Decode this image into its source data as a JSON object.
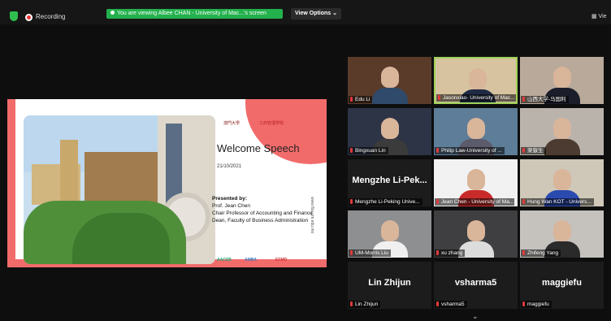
{
  "topbar": {
    "recording_label": "Recording",
    "viewing_banner": "You are viewing Albee CHAN - University of Mac...'s screen",
    "view_options_label": "View Options ⌄",
    "view_label": "▦ Vie"
  },
  "slide": {
    "title": "Welcome Speech",
    "date": "21/10/2021",
    "presented_by": "Presented by:",
    "presenter_name": "Prof. Jean Chen",
    "presenter_role1": "Chair Professor of Accounting and Finance",
    "presenter_role2": "Dean, Faculty of Business Administration",
    "url": "www.fba.um.edu.mo",
    "logo1": "澳門大學",
    "logo2": "工商管理學院",
    "footer_logos": [
      "AACSB",
      "AMBA",
      "EFMD"
    ]
  },
  "participants": [
    {
      "name": "Edu Li",
      "big": false
    },
    {
      "name": "Jasonxiao- University of Mac...",
      "big": false,
      "active": true
    },
    {
      "name": "山西大学-马国利",
      "big": false
    },
    {
      "name": "Bingxuan Lin",
      "big": false
    },
    {
      "name": "Philip Law-University of ...",
      "big": false
    },
    {
      "name": "梁嶽生",
      "big": false
    },
    {
      "name": "Mengzhe Li-Peking Unive...",
      "big": true,
      "bigname": "Mengzhe Li-Pek..."
    },
    {
      "name": "Jean Chen - University of Ma...",
      "big": false
    },
    {
      "name": "Hung Wan KOT - Univers...",
      "big": false
    },
    {
      "name": "UM-Morris Liu",
      "big": false
    },
    {
      "name": "xu zhang",
      "big": false
    },
    {
      "name": "Zhifeng Yang",
      "big": false
    },
    {
      "name": "Lin Zhijun",
      "big": true,
      "bigname": "Lin Zhijun"
    },
    {
      "name": "vsharma5",
      "big": true,
      "bigname": "vsharma5"
    },
    {
      "name": "maggiefu",
      "big": true,
      "bigname": "maggiefu"
    }
  ],
  "colors": {
    "accent_green": "#23b14d",
    "slide_red": "#f26b6b",
    "active_border": "#9fd157"
  },
  "icons": {
    "chevron": "⌄"
  }
}
